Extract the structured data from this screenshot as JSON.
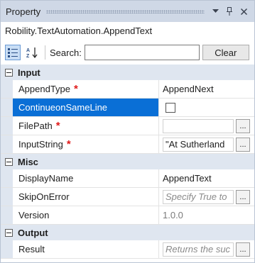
{
  "window": {
    "title": "Property"
  },
  "titlebar_icons": [
    "dropdown-icon",
    "pin-icon",
    "close-icon"
  ],
  "object_name": "Robility.TextAutomation.AppendText",
  "toolbar": {
    "search_label": "Search:",
    "search_value": "",
    "clear_label": "Clear"
  },
  "categories": {
    "input": {
      "label": "Input",
      "rows": [
        {
          "name": "AppendType",
          "required": "*",
          "value": "AppendNext"
        },
        {
          "name": "ContinueonSameLine",
          "value_type": "checkbox",
          "checked": false
        },
        {
          "name": "FilePath",
          "required": "*",
          "value": ""
        },
        {
          "name": "InputString",
          "required": "*",
          "value": "\"At Sutherland"
        }
      ]
    },
    "misc": {
      "label": "Misc",
      "rows": [
        {
          "name": "DisplayName",
          "value": "AppendText"
        },
        {
          "name": "SkipOnError",
          "placeholder": "Specify True to"
        },
        {
          "name": "Version",
          "value": "1.0.0"
        }
      ]
    },
    "output": {
      "label": "Output",
      "rows": [
        {
          "name": "Result",
          "placeholder": "Returns the suc"
        }
      ]
    }
  },
  "ellipsis": "...",
  "colors": {
    "selected": "#0a6fd6",
    "required": "#e01b1b",
    "category_bg": "#dfe6f0",
    "titlebar_bg": "#cfd8e6"
  }
}
